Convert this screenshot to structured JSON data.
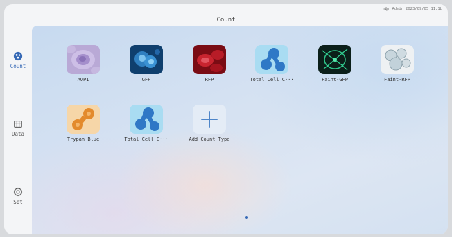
{
  "status": {
    "user": "Admin",
    "datetime": "2023/09/05 11:1b"
  },
  "header": {
    "title": "Count"
  },
  "sidebar": {
    "items": [
      {
        "label": "Count",
        "icon": "cells-icon",
        "active": true
      },
      {
        "label": "Data",
        "icon": "table-icon",
        "active": false
      },
      {
        "label": "Set",
        "icon": "gear-icon",
        "active": false
      }
    ]
  },
  "count_types": [
    {
      "label": "AOPI"
    },
    {
      "label": "GFP"
    },
    {
      "label": "RFP"
    },
    {
      "label": "Total Cell C···"
    },
    {
      "label": "Faint-GFP"
    },
    {
      "label": "Faint-RFP"
    },
    {
      "label": "Trypan Blue"
    },
    {
      "label": "Total Cell C···"
    },
    {
      "label": "Add Count Type"
    }
  ],
  "colors": {
    "accent": "#3568b5"
  },
  "pagination": {
    "pages": 1,
    "current": 1
  }
}
